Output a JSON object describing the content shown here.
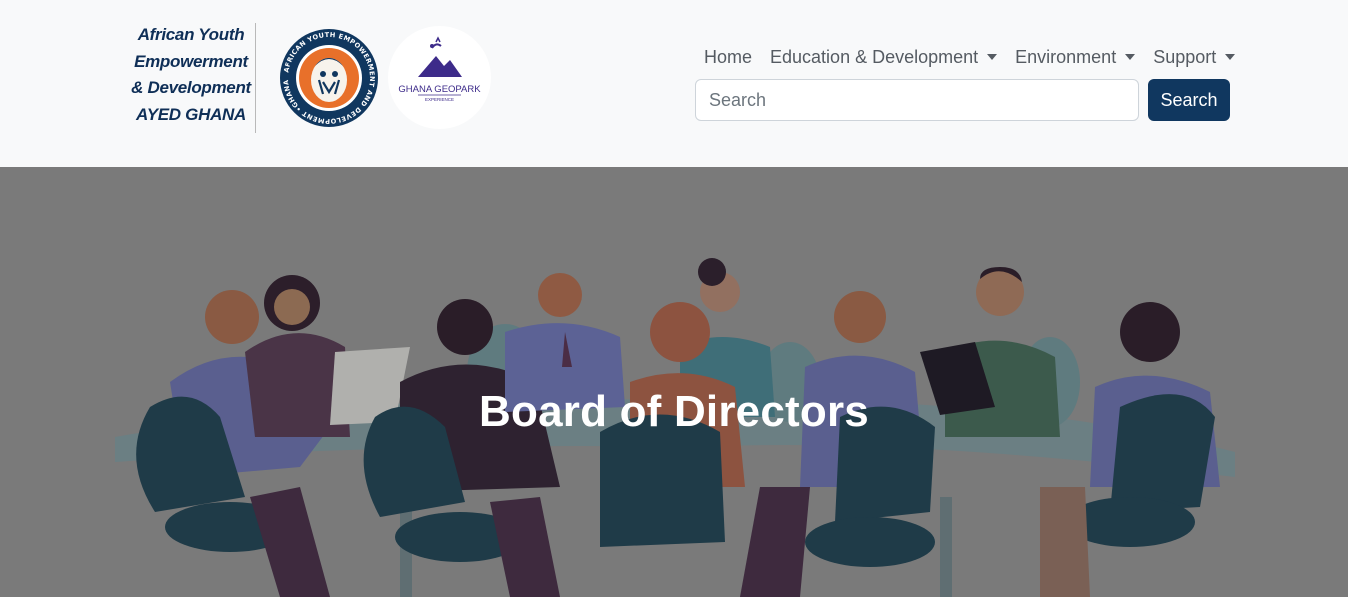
{
  "brand": {
    "lines": [
      "African Youth",
      "Empowerment",
      "& Development",
      "AYED GHANA"
    ],
    "logo_ring_text": "AFRICAN YOUTH EMPOWERMENT AND DEVELOPMENT •GHANA•",
    "geopark_name": "GHANA GEOPARK",
    "geopark_sub": "EXPERIENCE"
  },
  "nav": {
    "items": [
      {
        "label": "Home",
        "dropdown": false
      },
      {
        "label": "Education & Development",
        "dropdown": true
      },
      {
        "label": "Environment",
        "dropdown": true
      },
      {
        "label": "Support",
        "dropdown": true
      }
    ]
  },
  "search": {
    "placeholder": "Search",
    "button_label": "Search"
  },
  "hero": {
    "title": "Board of Directors",
    "overlay_color": "#7a7a7a"
  },
  "colors": {
    "brand_navy": "#10375f",
    "logo_orange": "#e8702a",
    "geopark_purple": "#3d2b8a"
  },
  "icons": {
    "dropdown": "caret-down-icon"
  }
}
